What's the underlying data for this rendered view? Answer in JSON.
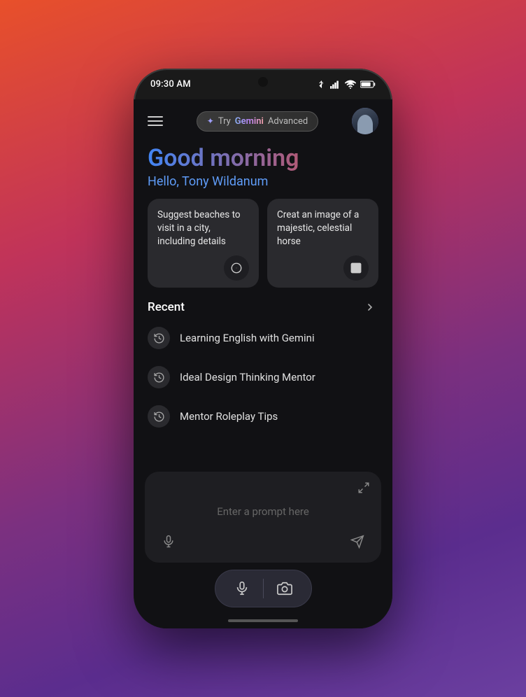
{
  "status_bar": {
    "time": "09:30 AM"
  },
  "header": {
    "try_button": {
      "plus_star": "✦",
      "try_label": "Try",
      "gemini_label": "Gemini",
      "advanced_label": "Advanced"
    }
  },
  "greeting": {
    "morning": "Good morning",
    "hello": "Hello, Tony Wildanum"
  },
  "suggestion_cards": [
    {
      "text": "Suggest beaches to visit in a city, including details",
      "icon_type": "compass"
    },
    {
      "text": "Creat an image of a majestic, celestial horse",
      "icon_type": "image"
    }
  ],
  "recent": {
    "title": "Recent",
    "items": [
      {
        "label": "Learning English with Gemini"
      },
      {
        "label": "Ideal Design Thinking Mentor"
      },
      {
        "label": "Mentor Roleplay Tips"
      }
    ]
  },
  "prompt_input": {
    "placeholder": "Enter a prompt here"
  },
  "bottom_pill": {
    "mic_label": "microphone",
    "camera_label": "camera"
  }
}
